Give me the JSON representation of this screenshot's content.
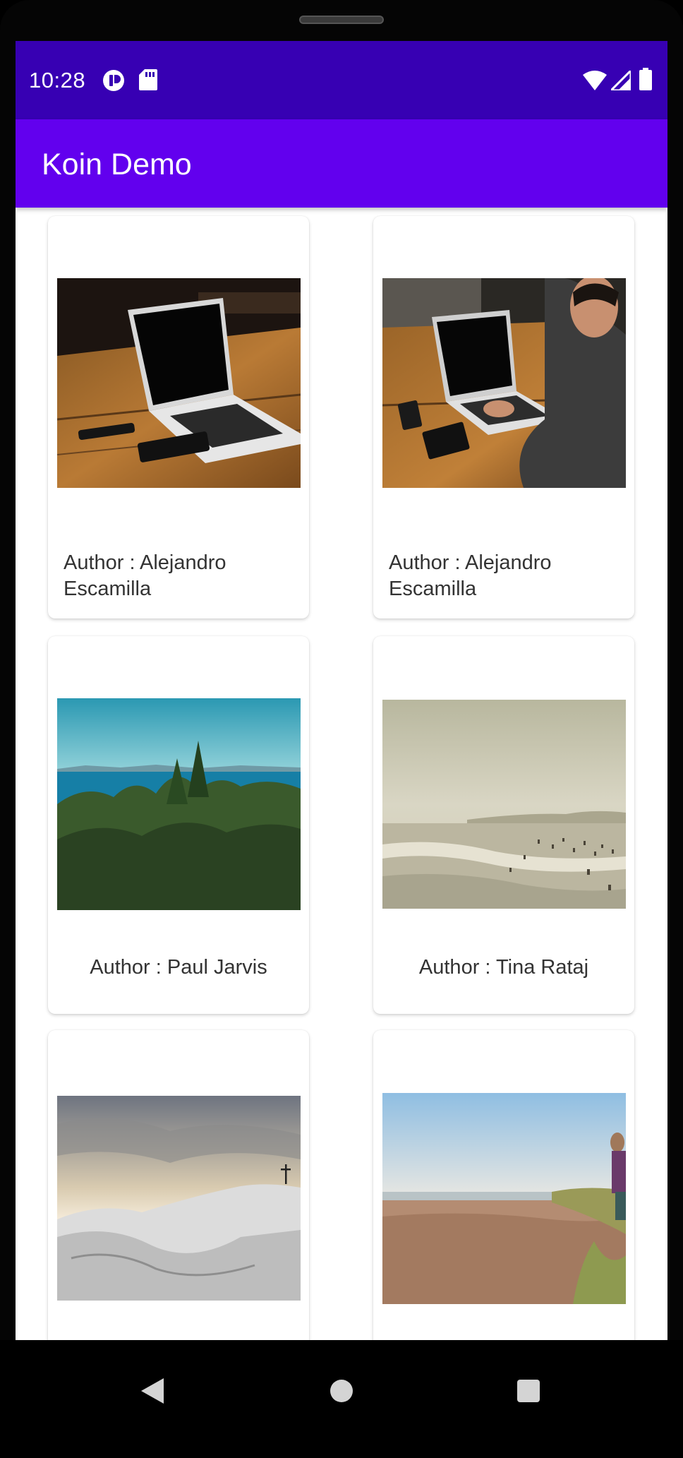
{
  "status_bar": {
    "time": "10:28",
    "icons": [
      "app-notification-icon",
      "sd-card-icon",
      "wifi-icon",
      "cellular-signal-icon",
      "battery-icon"
    ]
  },
  "app_bar": {
    "title": "Koin Demo",
    "background": "#6200ee",
    "status_background": "#3700b3"
  },
  "cards": [
    {
      "author_label": "Author : Alejandro Escamilla",
      "photo": "laptop on wooden desk"
    },
    {
      "author_label": "Author : Alejandro Escamilla",
      "photo": "person typing on laptop"
    },
    {
      "author_label": "Author : Paul Jarvis",
      "photo": "sea and evergreen trees"
    },
    {
      "author_label": "Author : Tina Rataj",
      "photo": "misty beach with swimmers"
    },
    {
      "author_label": "",
      "photo": "snowy hill with cross at sunset"
    },
    {
      "author_label": "",
      "photo": "sandy beach with person"
    }
  ],
  "nav_bar": {
    "buttons": [
      "back-icon",
      "home-icon",
      "recents-icon"
    ]
  }
}
